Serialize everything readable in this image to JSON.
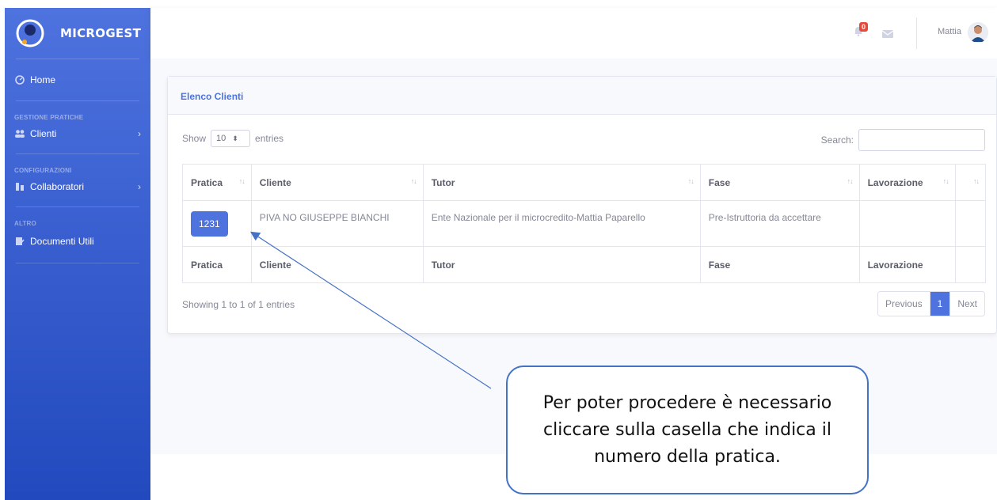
{
  "app": {
    "name": "MICROGEST"
  },
  "colors": {
    "primary": "#4e73df",
    "badge": "#e74a3b",
    "callout_border": "#4472c4"
  },
  "sidebar": {
    "home": {
      "label": "Home",
      "icon": "dashboard-icon"
    },
    "sections": [
      {
        "heading": "GESTIONE PRATICHE",
        "items": [
          {
            "label": "Clienti",
            "icon": "users-icon",
            "has_children": true
          }
        ]
      },
      {
        "heading": "CONFIGURAZIONI",
        "items": [
          {
            "label": "Collaboratori",
            "icon": "building-icon",
            "has_children": true
          }
        ]
      },
      {
        "heading": "ALTRO",
        "items": [
          {
            "label": "Documenti Utili",
            "icon": "document-icon",
            "has_children": false
          }
        ]
      }
    ]
  },
  "topbar": {
    "notifications_count": "0",
    "user_name": "Mattia"
  },
  "card": {
    "title": "Elenco Clienti",
    "show_label": "Show",
    "page_length": "10",
    "entries_label": "entries",
    "search_label": "Search:",
    "columns": [
      "Pratica",
      "Cliente",
      "Tutor",
      "Fase",
      "Lavorazione",
      ""
    ],
    "rows": [
      {
        "pratica": "1231",
        "cliente": "PIVA NO GIUSEPPE BIANCHI",
        "tutor": "Ente Nazionale per il microcredito-Mattia Paparello",
        "fase": "Pre-Istruttoria da accettare",
        "lavorazione": "",
        "extra": ""
      }
    ],
    "info": "Showing 1 to 1 of 1 entries",
    "pagination": {
      "previous": "Previous",
      "current": "1",
      "next": "Next"
    }
  },
  "callout": {
    "text": "Per poter procedere è necessario cliccare sulla casella che indica il numero della pratica."
  }
}
